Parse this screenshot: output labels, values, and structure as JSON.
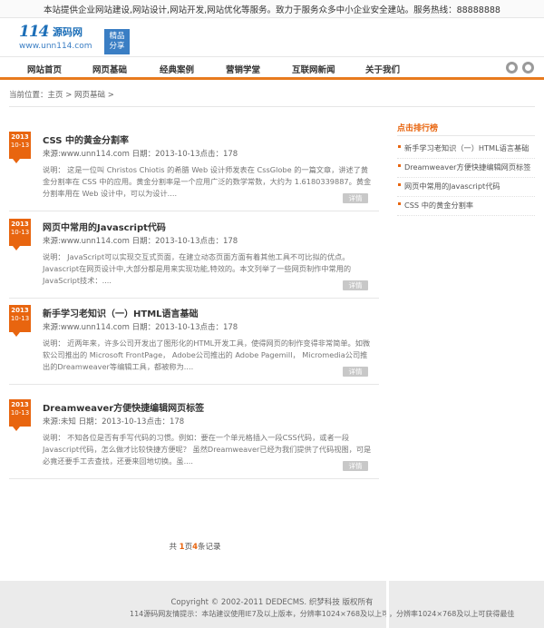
{
  "topbar": {
    "text": "本站提供企业网站建设,网站设计,网站开发,网站优化等服务。致力于服务众多中小企业安全建站。服务热线：88888888"
  },
  "logo": {
    "mark": "114",
    "name": "源码网",
    "url": "www.unn114.com",
    "badge_line1": "精品",
    "badge_line2": "分享"
  },
  "nav": {
    "items": [
      "网站首页",
      "网页基础",
      "经典案例",
      "营销学堂",
      "互联网新闻",
      "关于我们"
    ],
    "icons": [
      "weibo-icon",
      "qq-icon"
    ]
  },
  "breadcrumb": {
    "text": "当前位置：主页 > 网页基础 >"
  },
  "articles": [
    {
      "year": "2013",
      "month_day": "10-13",
      "title": "CSS 中的黄金分割率",
      "meta": "来源:www.unn114.com  日期：2013-10-13点击：178",
      "summary": "说明： 这是一位叫 Christos Chiotis 的希腊 Web 设计师发表在 CssGlobe 的一篇文章，讲述了黄金分割率在 CSS 中的应用。黄金分割率是一个应用广泛的数学常数，大约为 1.6180339887。黄金分割率用在 Web 设计中，可以为设计....",
      "more": "详情"
    },
    {
      "year": "2013",
      "month_day": "10-13",
      "title": "网页中常用的Javascript代码",
      "meta": "来源:www.unn114.com  日期：2013-10-13点击：178",
      "summary": "说明： JavaScript可以实现交互式页面，在建立动态页面方面有着其他工具不可比拟的优点。Javascript在网页设计中,大部分都是用来实现功能,特效的。本文列举了一些网页制作中常用的JavaScript技术：....",
      "more": "详情"
    },
    {
      "year": "2013",
      "month_day": "10-13",
      "title": "新手学习老知识（一）HTML语言基础",
      "meta": "来源:www.unn114.com  日期：2013-10-13点击：178",
      "summary": "说明： 近两年来，许多公司开发出了图形化的HTML开发工具，使得网页的制作变得非常简单。如微软公司推出的 Microsoft FrontPage， Adobe公司推出的 Adobe Pagemill， Micromedia公司推出的Dreamweaver等编辑工具，都被称为....",
      "more": "详情"
    },
    {
      "year": "2013",
      "month_day": "10-13",
      "title": "Dreamweaver方便快捷编辑网页标签",
      "meta": "来源:未知  日期：2013-10-13点击：178",
      "summary": "说明： 不知各位是否有手写代码的习惯。例如：要在一个单元格插入一段CSS代码，或者一段Javascript代码，怎么做才比较快捷方便呢？ 虽然Dreamweaver已经为我们提供了代码视图，可是必竟还要手工去查找，还要来回地切换。虽....",
      "more": "详情"
    }
  ],
  "sidebar": {
    "title": "点击排行榜",
    "items": [
      "新手学习老知识（一）HTML语言基础",
      "Dreamweaver方便快捷编辑网页标签",
      "网页中常用的Javascript代码",
      "CSS 中的黄金分割率"
    ]
  },
  "pagination": {
    "prefix": "共",
    "pages": "1",
    "mid": "页",
    "records": "4",
    "suffix": "条记录"
  },
  "footer": {
    "copyright": "Copyright © 2002-2011 DEDECMS. 织梦科技 版权所有",
    "tip": "114源码网友情提示：本站建议使用IE7及以上版本，分辨率1024×768及以上可获得最佳",
    "tip_right": "，分辨率1024×768及以上可获得最佳"
  }
}
